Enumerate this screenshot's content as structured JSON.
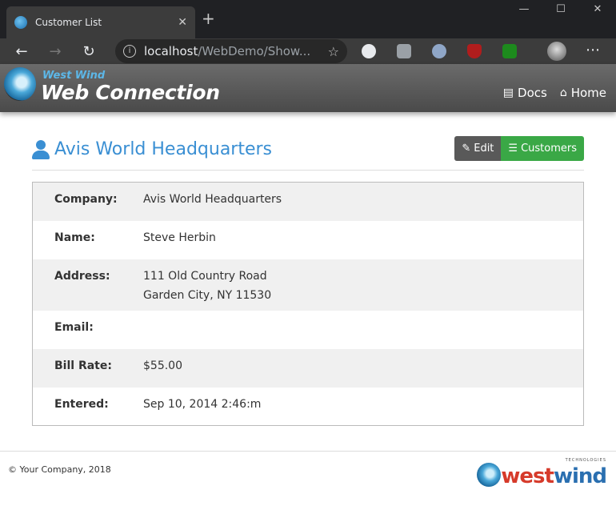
{
  "browser": {
    "tab_title": "Customer List",
    "url_host": "localhost",
    "url_path": "/WebDemo/Show...",
    "close_tab": "✕",
    "new_tab": "+",
    "minimize": "—",
    "maximize": "☐",
    "close_window": "✕",
    "back": "←",
    "forward": "→",
    "reload": "↻",
    "menu": "⋯"
  },
  "header": {
    "brand_top": "West Wind",
    "brand_main": "Web Connection",
    "nav": [
      {
        "label": "Docs",
        "icon": "book-icon"
      },
      {
        "label": "Home",
        "icon": "home-icon"
      }
    ]
  },
  "page": {
    "title": "Avis World Headquarters",
    "edit_label": "Edit",
    "customers_label": "Customers"
  },
  "details": [
    {
      "label": "Company:",
      "value": "Avis World Headquarters"
    },
    {
      "label": "Name:",
      "value": "Steve Herbin"
    },
    {
      "label": "Address:",
      "value": "111 Old Country Road",
      "value2": "Garden City, NY 11530"
    },
    {
      "label": "Email:",
      "value": ""
    },
    {
      "label": "Bill Rate:",
      "value": "$55.00"
    },
    {
      "label": "Entered:",
      "value": "Sep 10, 2014 2:46:m"
    }
  ],
  "footer": {
    "copyright": "© Your Company, 2018",
    "logo_west": "west",
    "logo_wind": "wind",
    "logo_tech": "TECHNOLOGIES"
  },
  "colors": {
    "accent": "#3a8fd3",
    "customers_button": "#3aa846",
    "edit_button": "#595959"
  }
}
